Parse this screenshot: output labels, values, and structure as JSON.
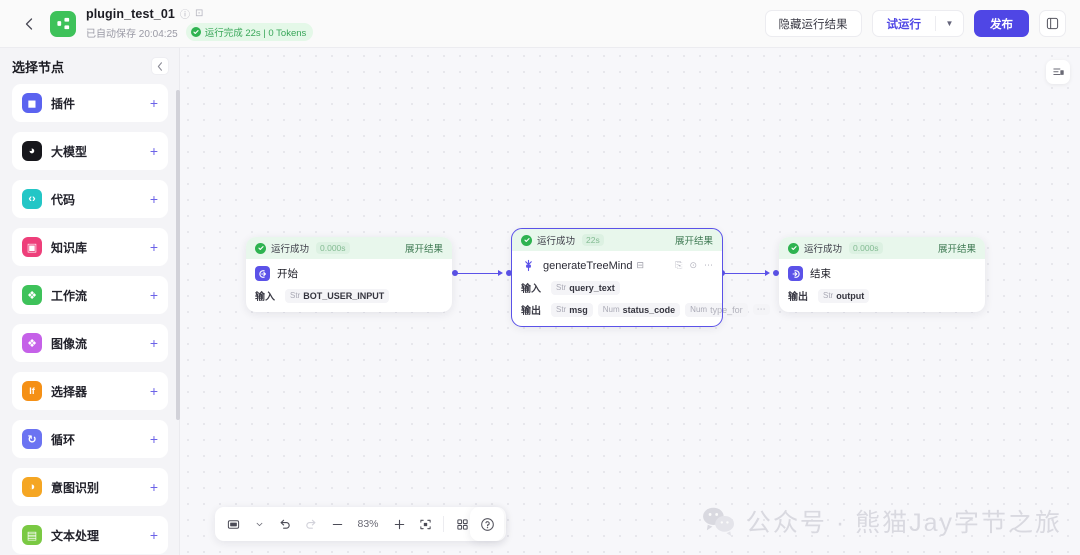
{
  "header": {
    "back_icon": "chevron-left-icon",
    "logo_icon": "workflow-logo-icon",
    "title": "plugin_test_01",
    "info_icon": "info-circle-icon",
    "edit_icon": "edit-square-icon",
    "saved_text": "已自动保存 20:04:25",
    "run_status": "运行完成 22s | 0 Tokens",
    "hide_result_label": "隐藏运行结果",
    "test_run_label": "试运行",
    "caret_icon": "chevron-down-icon",
    "publish_label": "发布",
    "panel_icon": "side-panel-icon"
  },
  "sidebar": {
    "title": "选择节点",
    "collapse_icon": "chevron-left-icon",
    "add_icon": "plus-icon",
    "items": [
      {
        "label": "插件",
        "icon": "plugin-icon",
        "color": "#5b63f0",
        "glyph": "◼"
      },
      {
        "label": "大模型",
        "icon": "llm-icon",
        "color": "#17171c",
        "glyph": "◕"
      },
      {
        "label": "代码",
        "icon": "code-icon",
        "color": "#23c6c6",
        "glyph": "‹›"
      },
      {
        "label": "知识库",
        "icon": "knowledge-base-icon",
        "color": "#ee3f7a",
        "glyph": "▣"
      },
      {
        "label": "工作流",
        "icon": "workflow-icon",
        "color": "#3ec25a",
        "glyph": "❖"
      },
      {
        "label": "图像流",
        "icon": "image-flow-icon",
        "color": "#c561e8",
        "glyph": "❖"
      },
      {
        "label": "选择器",
        "icon": "selector-icon",
        "color": "#f59016",
        "glyph": "If"
      },
      {
        "label": "循环",
        "icon": "loop-icon",
        "color": "#6b73f2",
        "glyph": "↻"
      },
      {
        "label": "意图识别",
        "icon": "intent-icon",
        "color": "#f5a623",
        "glyph": "◑"
      },
      {
        "label": "文本处理",
        "icon": "text-process-icon",
        "color": "#7ac943",
        "glyph": "▤"
      }
    ]
  },
  "canvas": {
    "layers_icon": "layers-list-icon",
    "nodes": [
      {
        "status": "运行成功",
        "time": "0.000s",
        "expand_label": "展开结果",
        "name": "开始",
        "icon": "start-node-icon",
        "icon_color": "#5b52e8",
        "rows": [
          {
            "label": "输入",
            "chips": [
              {
                "type": "Str",
                "name": "BOT_USER_INPUT",
                "dim": false
              }
            ],
            "more": false
          }
        ]
      },
      {
        "status": "运行成功",
        "time": "22s",
        "expand_label": "展开结果",
        "name": "generateTreeMind",
        "icon": "plugin-node-icon",
        "icon_color": "#ffffff",
        "copy_icon": "copy-icon",
        "settings_icon": "settings-icon",
        "more_icon": "more-dots-icon",
        "save_icon": "save-icon",
        "rows": [
          {
            "label": "输入",
            "chips": [
              {
                "type": "Str",
                "name": "query_text",
                "dim": false
              }
            ],
            "more": false
          },
          {
            "label": "输出",
            "chips": [
              {
                "type": "Str",
                "name": "msg",
                "dim": false
              },
              {
                "type": "Num",
                "name": "status_code",
                "dim": false
              },
              {
                "type": "Num",
                "name": "type_for",
                "dim": true
              }
            ],
            "more": true
          }
        ]
      },
      {
        "status": "运行成功",
        "time": "0.000s",
        "expand_label": "展开结果",
        "name": "结束",
        "icon": "end-node-icon",
        "icon_color": "#5b52e8",
        "rows": [
          {
            "label": "输出",
            "chips": [
              {
                "type": "Str",
                "name": "output",
                "dim": false
              }
            ],
            "more": false
          }
        ]
      }
    ]
  },
  "toolbar": {
    "cursor_icon": "cursor-select-icon",
    "cursor_caret_icon": "chevron-down-icon",
    "undo_icon": "undo-icon",
    "redo_icon": "redo-icon",
    "zoom_out_icon": "minus-icon",
    "zoom_level": "83%",
    "zoom_in_icon": "plus-icon",
    "fit_icon": "fit-view-icon",
    "grid_icon": "grid-layout-icon",
    "collapse_icon": "collapse-icon",
    "help_icon": "question-circle-icon"
  },
  "watermark": {
    "icon": "wechat-icon",
    "text": "公众号 · 熊猫Jay字节之旅"
  },
  "colors": {
    "accent": "#4f46e5",
    "success": "#2eb350",
    "success_bg": "#e8f7ec",
    "canvas_bg": "#f7f7fa"
  }
}
